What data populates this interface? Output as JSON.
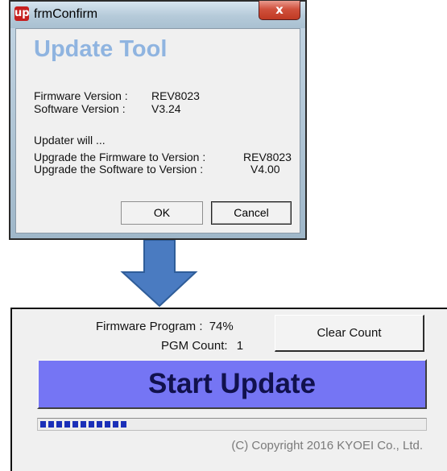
{
  "dialog": {
    "app_icon": "up",
    "title": "frmConfirm",
    "close_glyph": "x",
    "heading": "Update Tool",
    "firmware_label": "Firmware Version :",
    "firmware_value": "REV8023",
    "software_label": "Software Version :",
    "software_value": "V3.24",
    "updater_will": "Updater will ...",
    "upgrade_fw_label": "Upgrade the Firmware to Version :",
    "upgrade_fw_value": "REV8023",
    "upgrade_sw_label": "Upgrade the Software to Version :",
    "upgrade_sw_value": "V4.00",
    "ok_label": "OK",
    "cancel_label": "Cancel"
  },
  "arrow": {
    "color": "#4a7bc1",
    "direction": "down"
  },
  "panel": {
    "firmware_program_label": "Firmware Program :",
    "firmware_program_value": "74%",
    "pgm_count_label": "PGM Count:",
    "pgm_count_value": "1",
    "clear_count_label": "Clear Count",
    "start_update_label": "Start Update",
    "progress_fraction": 0.23,
    "copyright": "(C) Copyright 2016  KYOEI  Co., Ltd.",
    "colors": {
      "start_button": "#7575f4",
      "progress": "#1a2fb8"
    }
  }
}
